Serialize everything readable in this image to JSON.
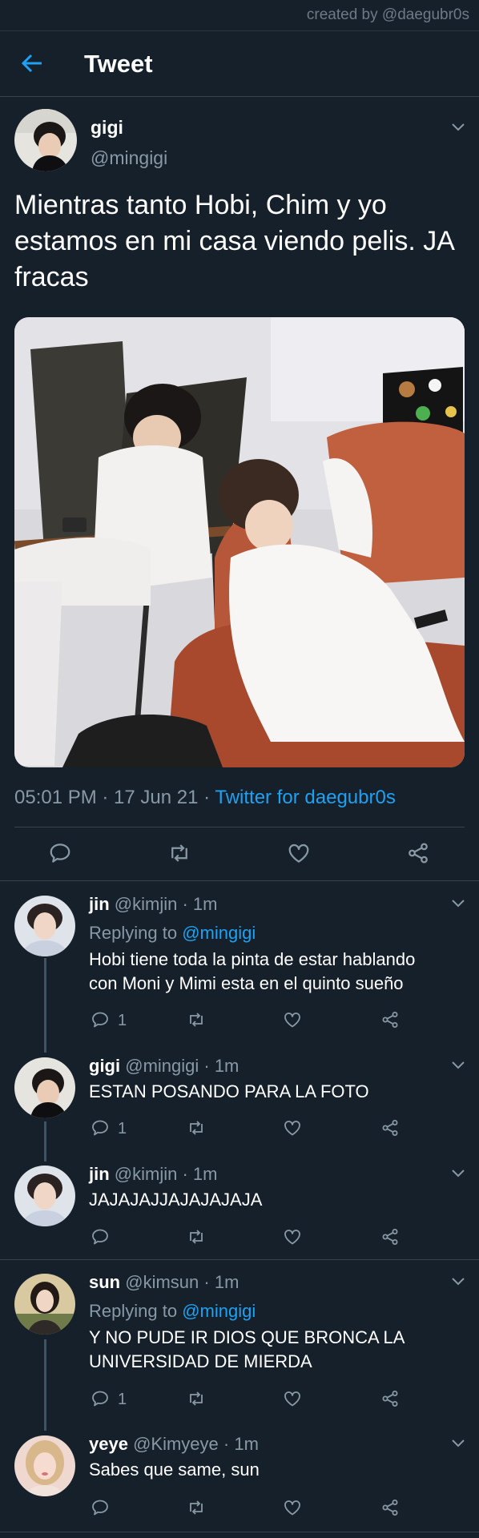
{
  "credit": "created by @daegubr0s",
  "header": {
    "title": "Tweet"
  },
  "tweet": {
    "name": "gigi",
    "handle": "@mingigi",
    "text": "Mientras tanto Hobi, Chim y yo estamos en mi casa viendo pelis. JA fracas",
    "meta_time": "05:01 PM · 17 Jun 21 · ",
    "meta_source": "Twitter for daegubr0s"
  },
  "replies": [
    {
      "name": "jin",
      "handle": "@kimjin",
      "time": " · 1m",
      "replying_prefix": "Replying to ",
      "replying_to": "@mingigi",
      "text_lines": [
        "Hobi tiene toda la pinta de estar hablando",
        "con Moni y Mimi esta en el quinto sueño"
      ],
      "reply_count": "1"
    },
    {
      "name": "gigi",
      "handle": "@mingigi",
      "time": " · 1m",
      "text_lines": [
        "ESTAN POSANDO PARA LA FOTO"
      ],
      "reply_count": "1"
    },
    {
      "name": "jin",
      "handle": "@kimjin",
      "time": " · 1m",
      "text_lines": [
        "JAJAJAJJAJAJAJAJA"
      ],
      "reply_count": ""
    },
    {
      "name": "sun",
      "handle": "@kimsun",
      "time": " · 1m",
      "replying_prefix": "Replying to ",
      "replying_to": "@mingigi",
      "text_lines": [
        "Y NO PUDE IR DIOS QUE BRONCA LA",
        "UNIVERSIDAD DE MIERDA"
      ],
      "reply_count": "1"
    },
    {
      "name": "yeye",
      "handle": "@Kimyeye",
      "time": " · 1m",
      "text_lines": [
        "Sabes que same, sun"
      ],
      "reply_count": ""
    }
  ],
  "icons": {
    "back": "back-arrow-icon",
    "chevron": "chevron-down-icon",
    "reply": "reply-icon",
    "retweet": "retweet-icon",
    "like": "heart-icon",
    "share": "share-icon"
  },
  "colors": {
    "background": "#15202b",
    "accent": "#1da1f2",
    "muted": "#8899a6",
    "border": "#38444d"
  }
}
